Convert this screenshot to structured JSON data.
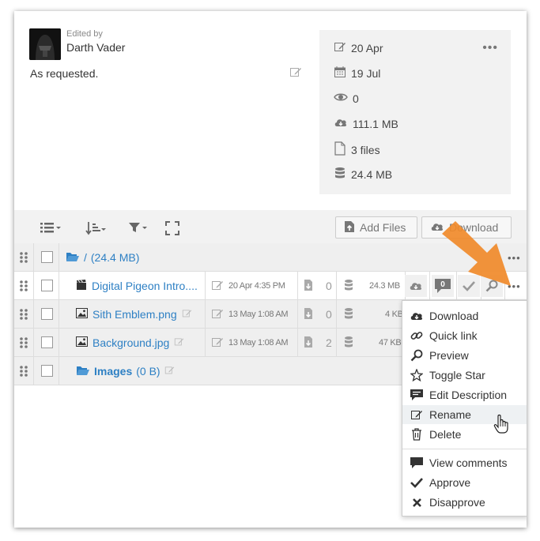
{
  "header": {
    "edited_by_label": "Edited by",
    "author": "Darth Vader",
    "description": "As requested.",
    "meta": {
      "modified": "20 Apr",
      "date": "19 Jul",
      "views": "0",
      "downloaded": "111.1 MB",
      "files": "3 files",
      "size": "24.4 MB"
    }
  },
  "toolbar": {
    "add_files": "Add Files",
    "download": "Download"
  },
  "table": {
    "root": {
      "name": "/",
      "size": "(24.4 MB)"
    },
    "files": [
      {
        "name": "Digital Pigeon Intro....",
        "date": "20 Apr 4:35 PM",
        "downloads": "0",
        "size": "24.3 MB",
        "comments": "0"
      },
      {
        "name": "Sith Emblem.png",
        "date": "13 May 1:08 AM",
        "downloads": "0",
        "size": "4 KB"
      },
      {
        "name": "Background.jpg",
        "date": "13 May 1:08 AM",
        "downloads": "2",
        "size": "47 KB"
      }
    ],
    "folder": {
      "name": "Images",
      "size": "(0 B)"
    }
  },
  "menu": {
    "items": [
      "Download",
      "Quick link",
      "Preview",
      "Toggle Star",
      "Edit Description",
      "Rename",
      "Delete"
    ],
    "items2": [
      "View comments",
      "Approve",
      "Disapprove"
    ]
  },
  "colors": {
    "link": "#2e80c4",
    "arrow": "#f08a2a",
    "panel": "#f2f2f2"
  }
}
